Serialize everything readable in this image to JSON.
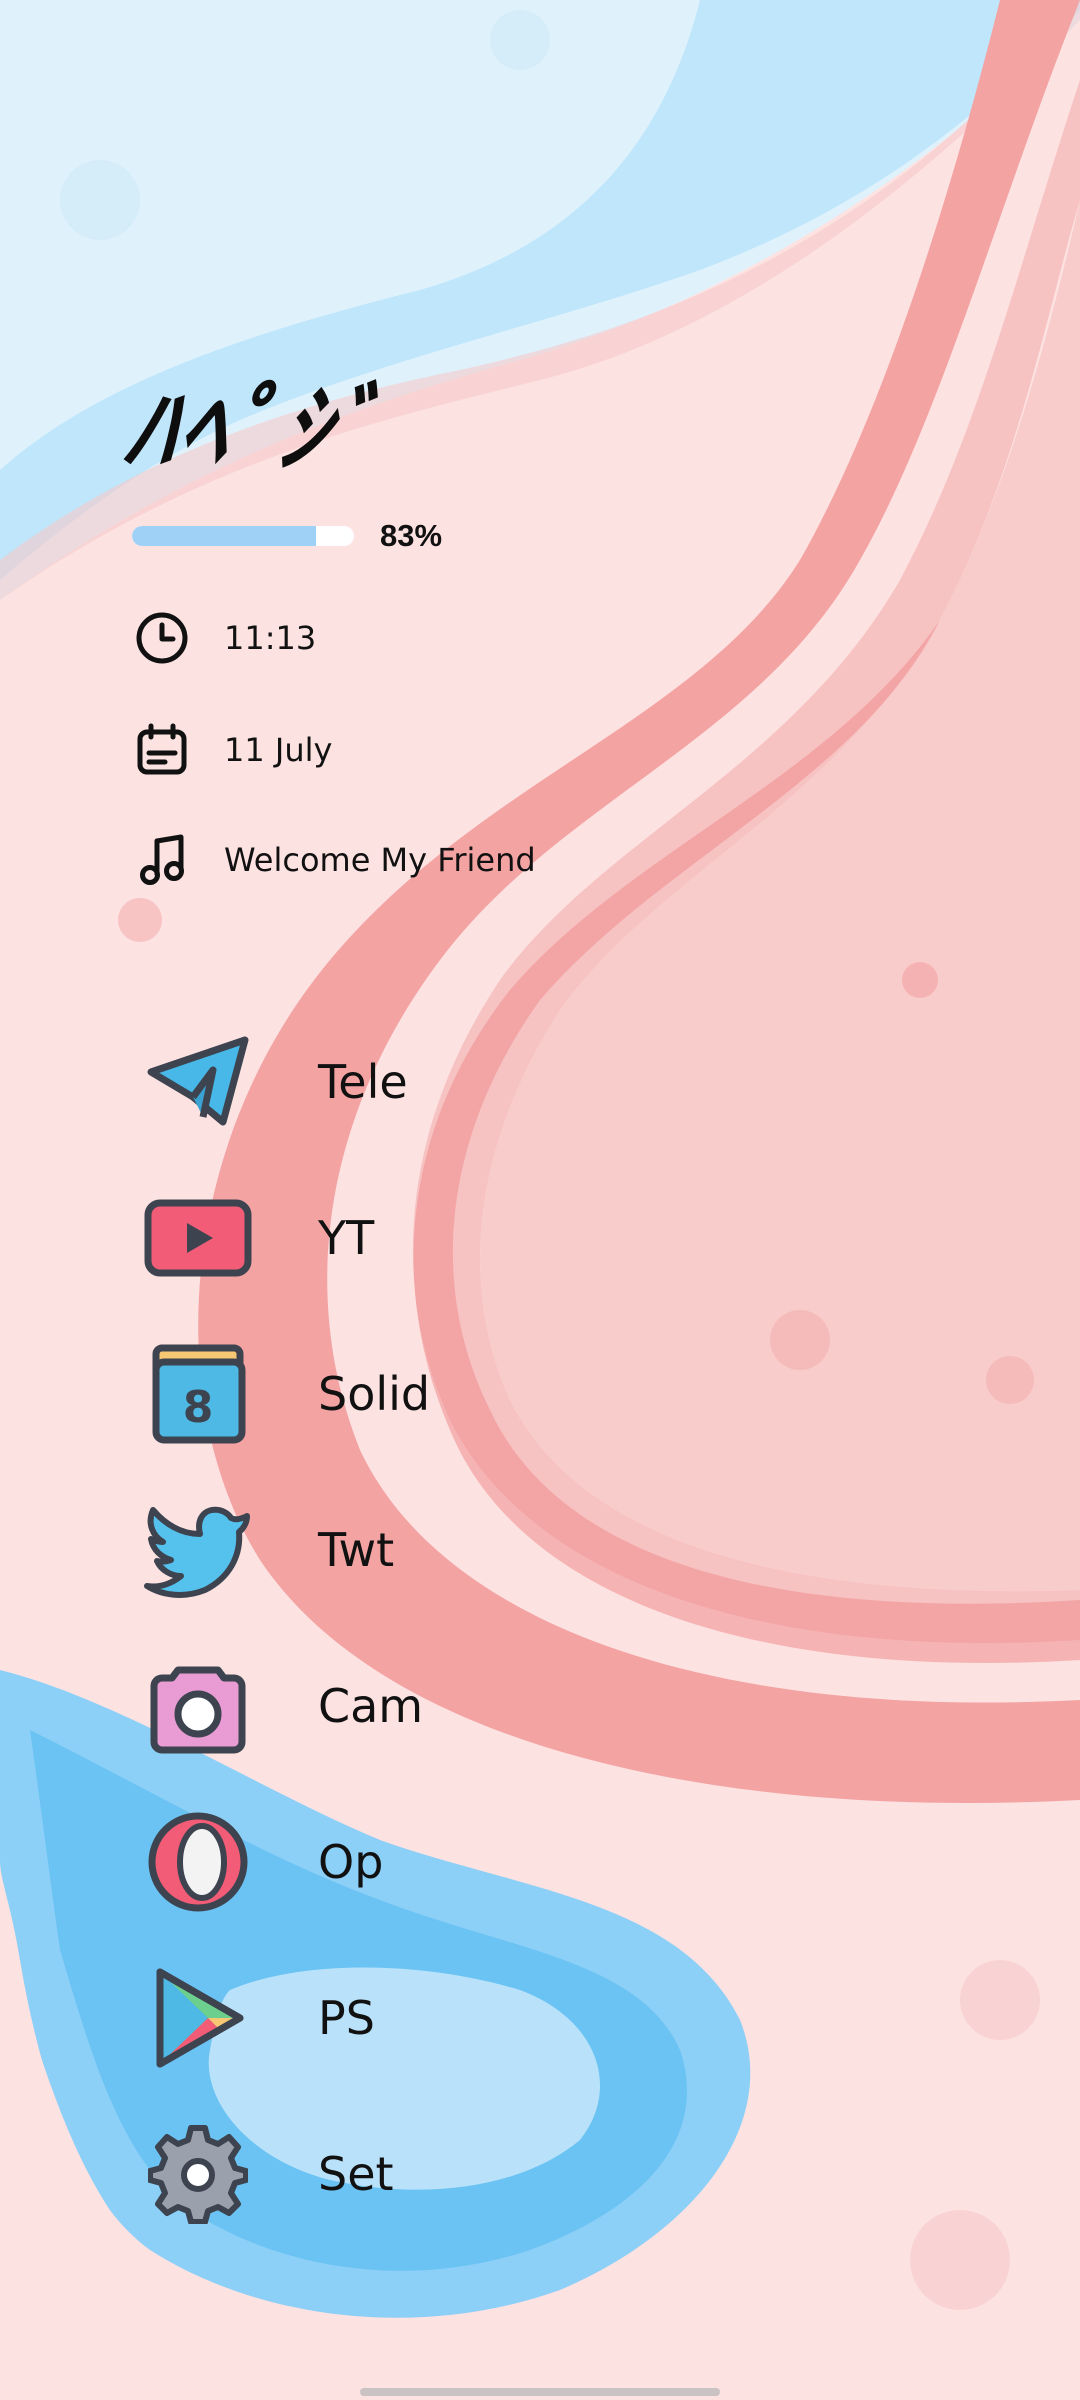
{
  "header": {
    "title": "ﾊﾍﾟｼﾞ"
  },
  "battery": {
    "percent_label": "83%",
    "level": 0.83
  },
  "info": {
    "time": "11:13",
    "date": "11 July",
    "music": "Welcome My Friend"
  },
  "apps": [
    {
      "label": "Tele",
      "icon": "telegram-icon"
    },
    {
      "label": "YT",
      "icon": "youtube-icon"
    },
    {
      "label": "Solid",
      "icon": "solid-explorer-icon"
    },
    {
      "label": "Twt",
      "icon": "twitter-icon"
    },
    {
      "label": "Cam",
      "icon": "camera-icon"
    },
    {
      "label": "Op",
      "icon": "opera-icon"
    },
    {
      "label": "PS",
      "icon": "play-store-icon"
    },
    {
      "label": "Set",
      "icon": "settings-gear-icon"
    }
  ],
  "colors": {
    "battery_fill": "#9fd0f5",
    "sky_blue": "#bde6fb",
    "coral": "#f59b9b",
    "lagoon_blue": "#6cc2f4"
  }
}
